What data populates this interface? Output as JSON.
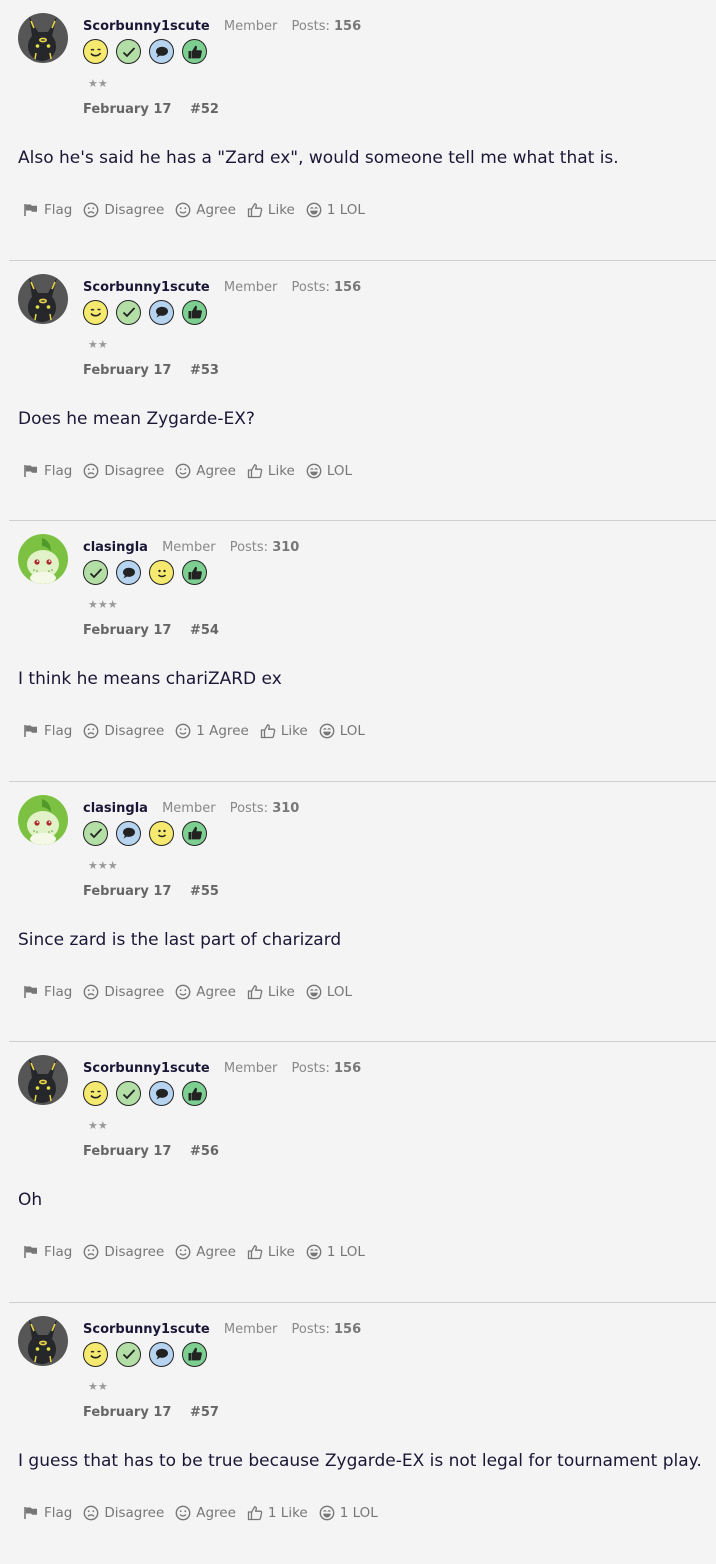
{
  "posts": [
    {
      "user": "Scorbunny1scute",
      "role": "Member",
      "posts_label": "Posts:",
      "posts": "156",
      "avatar": "umbreon-avatar",
      "badges": [
        "wink-badge",
        "check-badge",
        "speech-badge",
        "thumbs-up-badge"
      ],
      "stars": "★★",
      "date": "February 17",
      "number": "#52",
      "body": "Also he's said he has a \"Zard ex\", would someone tell me what that is.",
      "actions": {
        "flag": "Flag",
        "disagree": "Disagree",
        "agree": "Agree",
        "like": "Like",
        "lol": "1 LOL"
      }
    },
    {
      "user": "Scorbunny1scute",
      "role": "Member",
      "posts_label": "Posts:",
      "posts": "156",
      "avatar": "umbreon-avatar",
      "badges": [
        "wink-badge",
        "check-badge",
        "speech-badge",
        "thumbs-up-badge"
      ],
      "stars": "★★",
      "date": "February 17",
      "number": "#53",
      "body": "Does he mean Zygarde-EX?",
      "actions": {
        "flag": "Flag",
        "disagree": "Disagree",
        "agree": "Agree",
        "like": "Like",
        "lol": "LOL"
      }
    },
    {
      "user": "clasingla",
      "role": "Member",
      "posts_label": "Posts:",
      "posts": "310",
      "avatar": "chikorita-avatar",
      "badges": [
        "check-badge",
        "speech-badge",
        "smile-badge",
        "thumbs-up-badge"
      ],
      "stars": "★★★",
      "date": "February 17",
      "number": "#54",
      "body": "I think he means chariZARD ex",
      "actions": {
        "flag": "Flag",
        "disagree": "Disagree",
        "agree": "1 Agree",
        "like": "Like",
        "lol": "LOL"
      }
    },
    {
      "user": "clasingla",
      "role": "Member",
      "posts_label": "Posts:",
      "posts": "310",
      "avatar": "chikorita-avatar",
      "badges": [
        "check-badge",
        "speech-badge",
        "smile-badge",
        "thumbs-up-badge"
      ],
      "stars": "★★★",
      "date": "February 17",
      "number": "#55",
      "body": "Since zard is the last part of charizard",
      "actions": {
        "flag": "Flag",
        "disagree": "Disagree",
        "agree": "Agree",
        "like": "Like",
        "lol": "LOL"
      }
    },
    {
      "user": "Scorbunny1scute",
      "role": "Member",
      "posts_label": "Posts:",
      "posts": "156",
      "avatar": "umbreon-avatar",
      "badges": [
        "wink-badge",
        "check-badge",
        "speech-badge",
        "thumbs-up-badge"
      ],
      "stars": "★★",
      "date": "February 17",
      "number": "#56",
      "body": "Oh",
      "actions": {
        "flag": "Flag",
        "disagree": "Disagree",
        "agree": "Agree",
        "like": "Like",
        "lol": "1 LOL"
      }
    },
    {
      "user": "Scorbunny1scute",
      "role": "Member",
      "posts_label": "Posts:",
      "posts": "156",
      "avatar": "umbreon-avatar",
      "badges": [
        "wink-badge",
        "check-badge",
        "speech-badge",
        "thumbs-up-badge"
      ],
      "stars": "★★",
      "date": "February 17",
      "number": "#57",
      "body": "I guess that has to be true because Zygarde-EX is not legal for tournament play.",
      "actions": {
        "flag": "Flag",
        "disagree": "Disagree",
        "agree": "Agree",
        "like": "1 Like",
        "lol": "1 LOL"
      }
    }
  ]
}
